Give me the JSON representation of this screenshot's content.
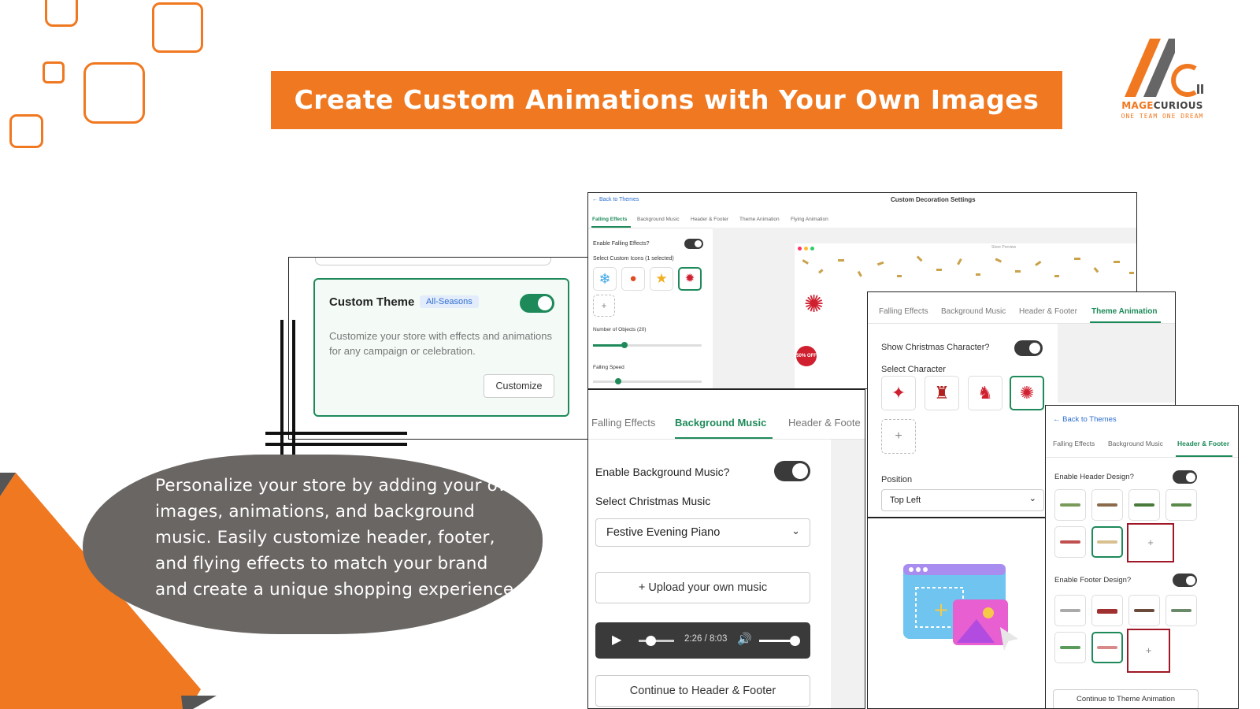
{
  "banner": {
    "title": "Create Custom Animations with Your Own Images"
  },
  "logo": {
    "brand_first": "MAGE",
    "brand_second": "CURIOUS",
    "tagline": "ONE TEAM ONE DREAM"
  },
  "colors": {
    "accent": "#f07820",
    "green": "#1e8a5a",
    "blob": "#6a6664",
    "dark_player": "#3a3a3a"
  },
  "theme_card": {
    "title": "Custom Theme",
    "badge": "All-Seasons",
    "description": "Customize your store with effects and animations for any campaign or celebration.",
    "button": "Customize"
  },
  "blob": {
    "text": "Personalize your store by adding your own images, animations, and background music. Easily customize header, footer, and flying effects to match your brand and create a unique shopping experience."
  },
  "settings": {
    "back": "← Back to Themes",
    "title": "Custom Decoration Settings",
    "tabs": [
      "Falling Effects",
      "Background Music",
      "Header & Footer",
      "Theme Animation",
      "Flying Animation"
    ],
    "enable_falling": "Enable Falling Effects?",
    "select_icons": "Select Custom Icons (1 selected)",
    "icons": [
      "snowflake-icon",
      "ornament-icon",
      "star-icon",
      "sale-badge-icon"
    ],
    "add": "+",
    "objects_label": "Number of Objects (20)",
    "speed_label": "Falling Speed",
    "preview_label": "Store Preview",
    "badge_text": "50% OFF"
  },
  "music": {
    "tabs": [
      "Falling Effects",
      "Background Music",
      "Header & Foote"
    ],
    "enable": "Enable Background Music?",
    "select_label": "Select Christmas Music",
    "selected": "Festive Evening Piano",
    "upload": "+ Upload your own music",
    "time": "2:26 / 8:03",
    "continue": "Continue to Header & Footer"
  },
  "character": {
    "tabs": [
      "Falling Effects",
      "Background Music",
      "Header & Footer",
      "Theme Animation"
    ],
    "show": "Show Christmas Character?",
    "select": "Select Character",
    "characters": [
      "santa-1-icon",
      "santa-2-icon",
      "santa-3-icon",
      "santa-4-icon"
    ],
    "add": "+",
    "position_label": "Position",
    "position": "Top Left"
  },
  "header_footer": {
    "back": "← Back to Themes",
    "tabs": [
      "Falling Effects",
      "Background Music",
      "Header & Footer"
    ],
    "enable_header": "Enable Header Design?",
    "enable_footer": "Enable Footer Design?",
    "add": "+",
    "continue": "Continue to Theme Animation"
  }
}
